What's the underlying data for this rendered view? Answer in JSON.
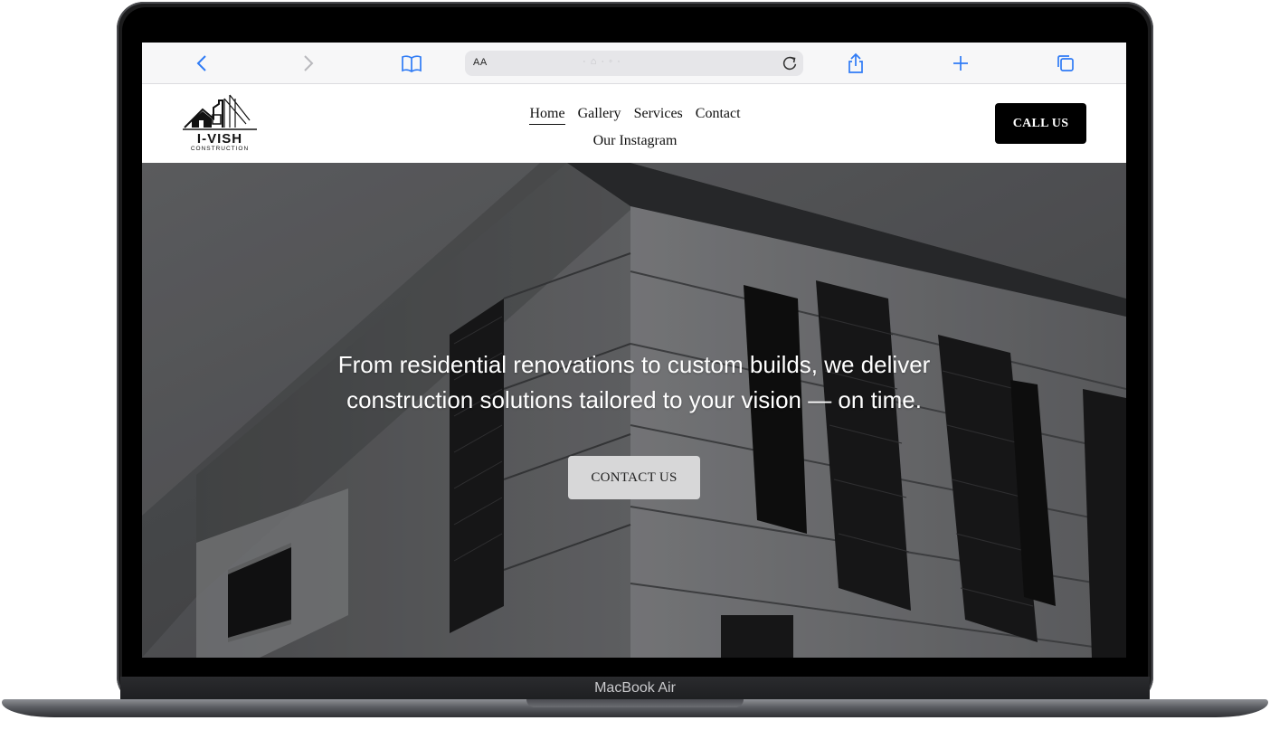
{
  "device": {
    "label": "MacBook Air"
  },
  "browser": {
    "reader_label": "AA",
    "address_text": "· ⌂ · ◦ ·",
    "icons": [
      "back-icon",
      "forward-icon",
      "bookmarks-icon",
      "reload-icon",
      "share-icon",
      "new-tab-icon",
      "tabs-icon"
    ]
  },
  "site": {
    "logo": {
      "name": "I-VISH",
      "tagline": "CONSTRUCTION"
    },
    "nav": {
      "items": [
        {
          "label": "Home",
          "active": true
        },
        {
          "label": "Gallery"
        },
        {
          "label": "Services"
        },
        {
          "label": "Contact"
        },
        {
          "label": "Our Instagram"
        }
      ]
    },
    "call_button": "CALL US",
    "hero": {
      "headline": "From residential renovations to custom builds, we deliver construction solutions tailored to your vision — on time.",
      "cta": "CONTACT US"
    }
  },
  "colors": {
    "accent_link": "#2f7bf5",
    "button_dark": "#000000",
    "button_light": "#d7d7d8"
  }
}
